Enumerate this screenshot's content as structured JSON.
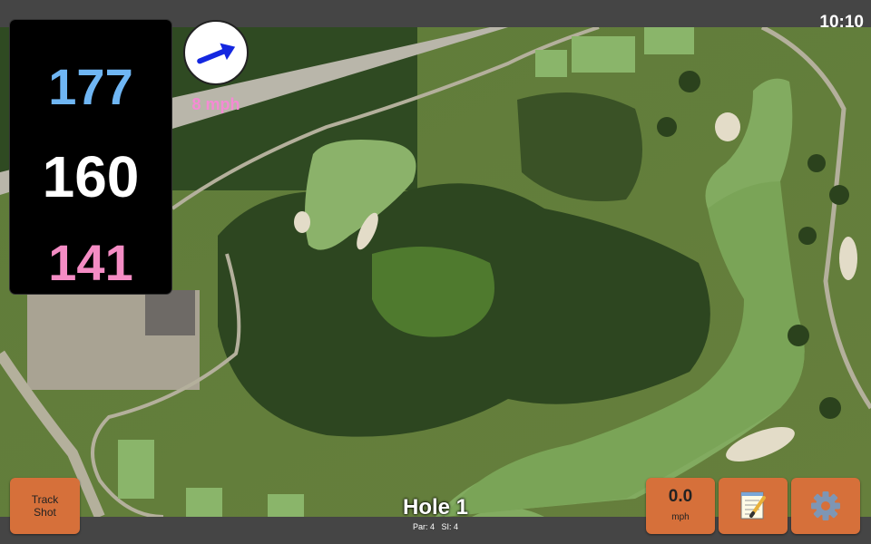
{
  "status": {
    "time": "10:10"
  },
  "distances": {
    "back": "177",
    "middle": "160",
    "front": "141",
    "colors": {
      "back": "#6fb6f4",
      "middle": "#ffffff",
      "front": "#f48cc4"
    }
  },
  "wind": {
    "speed_label": "8 mph",
    "icon": "wind-direction-arrow-icon",
    "arrow_color": "#1427e0",
    "label_color": "#f58ad4"
  },
  "buttons": {
    "track_shot": {
      "line1": "Track",
      "line2": "Shot"
    },
    "speed": {
      "value": "0.0",
      "unit": "mph"
    },
    "notes": {
      "icon": "notepad-icon"
    },
    "settings": {
      "icon": "gear-icon"
    },
    "color": "#d6703a"
  },
  "hole": {
    "title": "Hole 1",
    "par_label": "Par: 4",
    "si_label": "SI: 4"
  },
  "map": {
    "type": "satellite-golf-course"
  }
}
